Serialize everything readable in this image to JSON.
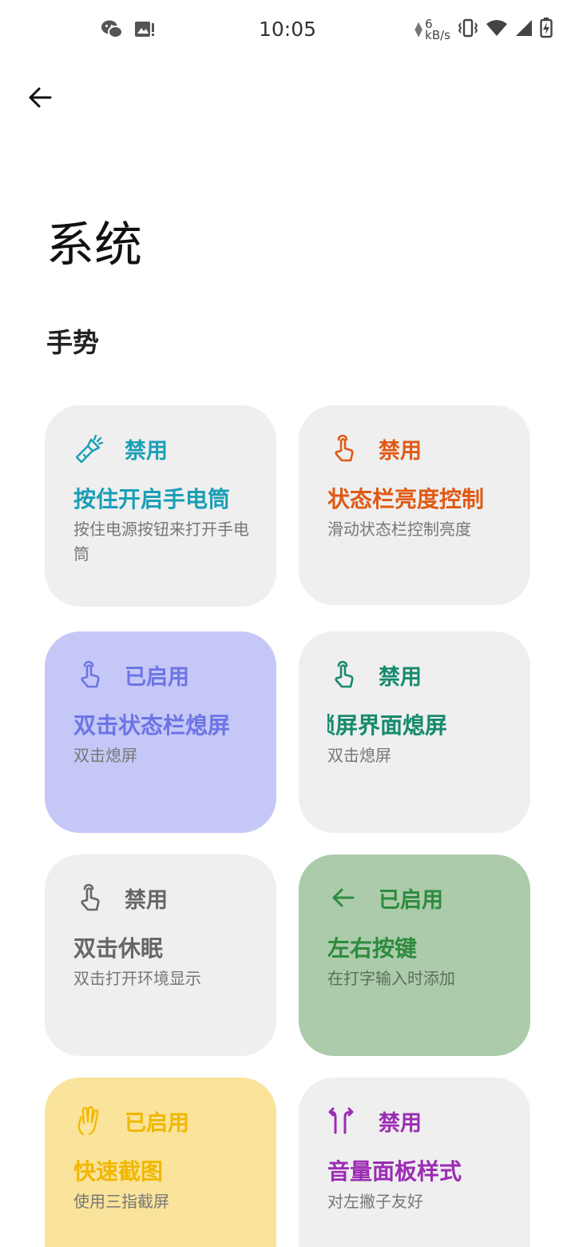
{
  "status_bar": {
    "time": "10:05",
    "net_speed_value": "6",
    "net_speed_unit": "kB/s"
  },
  "page": {
    "title": "系统",
    "section": "手势"
  },
  "colors": {
    "teal": "#1a9fb6",
    "orange": "#e05a14",
    "periwinkle": "#6d74e6",
    "periwinkle_bg": "#c5c8f7",
    "dark_teal": "#168a6e",
    "gray": "#666666",
    "green": "#2e8b3e",
    "green_bg": "#abcbab",
    "amber": "#f0b800",
    "amber_bg": "#fae39a",
    "purple": "#9b2cb4",
    "card_bg": "#efefef"
  },
  "cards": [
    {
      "status": "禁用",
      "title": "按住开启手电筒",
      "desc": "按住电源按钮来打开手电筒",
      "icon": "flashlight-icon"
    },
    {
      "status": "禁用",
      "title": "状态栏亮度控制",
      "desc": "滑动状态栏控制亮度",
      "icon": "touch-hand-icon"
    },
    {
      "status": "已启用",
      "title": "双击状态栏熄屏",
      "desc": "双击熄屏",
      "icon": "touch-hand-icon"
    },
    {
      "status": "禁用",
      "title": "锁屏界面熄屏",
      "desc": "双击熄屏",
      "icon": "touch-hand-icon"
    },
    {
      "status": "禁用",
      "title": "双击休眠",
      "desc": "双击打开环境显示",
      "icon": "touch-hand-icon"
    },
    {
      "status": "已启用",
      "title": "左右按键",
      "desc": "在打字输入时添加",
      "icon": "arrow-left-icon"
    },
    {
      "status": "已启用",
      "title": "快速截图",
      "desc": "使用三指截屏",
      "icon": "three-finger-icon"
    },
    {
      "status": "禁用",
      "title": "音量面板样式",
      "desc": "对左撇子友好",
      "icon": "split-arrows-icon"
    }
  ]
}
